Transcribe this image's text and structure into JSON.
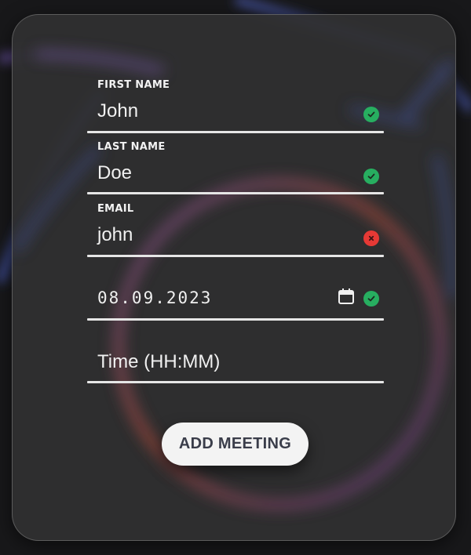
{
  "form": {
    "first_name": {
      "label": "FIRST NAME",
      "value": "John",
      "status": "valid"
    },
    "last_name": {
      "label": "LAST NAME",
      "value": "Doe",
      "status": "valid"
    },
    "email": {
      "label": "EMAIL",
      "value": "john",
      "status": "invalid"
    },
    "date": {
      "value": "08.09.2023",
      "status": "valid",
      "picker_icon": "calendar-icon"
    },
    "time": {
      "placeholder": "Time (HH:MM)"
    },
    "submit_label": "ADD MEETING"
  },
  "colors": {
    "valid": "#27ae60",
    "invalid": "#e53935",
    "card": "#303032",
    "button_text": "#3a3d4a"
  }
}
